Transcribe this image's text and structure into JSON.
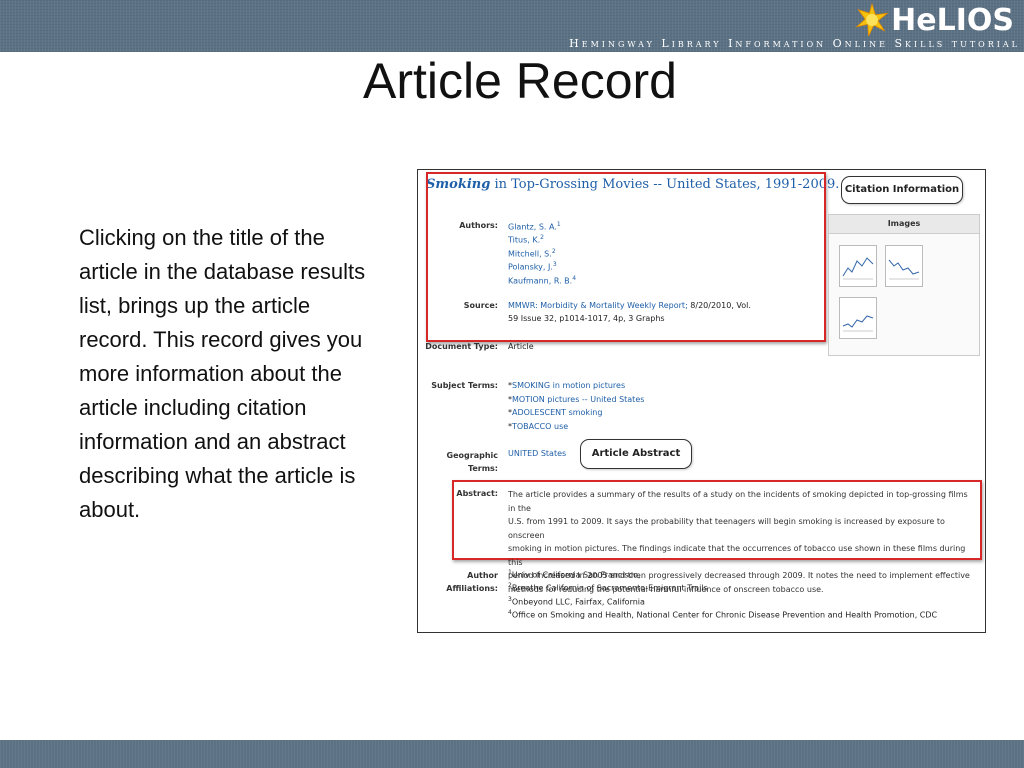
{
  "header": {
    "logo_text": "HeLIOS",
    "tagline": "Hemingway Library Information Online Skills tutorial"
  },
  "slide": {
    "title": "Article Record",
    "body": "Clicking on the title of the article in the database results list, brings up the article record.  This record gives you more information about the article including citation information and an abstract describing what the article is about."
  },
  "record": {
    "title_bold": "Smoking",
    "title_rest": " in Top-Grossing Movies -- United States, 1991-2009.",
    "callout_citation": "Citation Information",
    "callout_abstract": "Article Abstract",
    "images_header": "Images",
    "authors_label": "Authors:",
    "authors": [
      {
        "name": "Glantz, S. A.",
        "sup": "1"
      },
      {
        "name": "Titus, K.",
        "sup": "2"
      },
      {
        "name": "Mitchell, S.",
        "sup": "2"
      },
      {
        "name": "Polansky, J.",
        "sup": "3"
      },
      {
        "name": "Kaufmann, R. B.",
        "sup": "4"
      }
    ],
    "source_label": "Source:",
    "source_link": "MMWR: Morbidity & Mortality Weekly Report;",
    "source_line1_rest": " 8/20/2010, Vol.",
    "source_line2": "59 Issue 32, p1014-1017, 4p, 3 Graphs",
    "doctype_label": "Document Type:",
    "doctype": "Article",
    "subjects_label": "Subject Terms:",
    "subjects": [
      "SMOKING in motion pictures",
      "MOTION pictures -- United States",
      "ADOLESCENT smoking",
      "TOBACCO use"
    ],
    "geo_label_1": "Geographic",
    "geo_label_2": "Terms:",
    "geo": "UNITED States",
    "abstract_label": "Abstract:",
    "abstract_lines": [
      "The article provides a summary of the results of a study on the incidents of smoking depicted in top-grossing films in the",
      "U.S. from 1991 to 2009. It says the probability that teenagers will begin smoking is increased by exposure to onscreen",
      "smoking in motion pictures. The findings indicate that the occurrences of tobacco use shown in these films during this",
      "period increased in 2005 and then progressively decreased through 2009. It notes the need to implement effective",
      "methods for reducing the potential harmful influence of onscreen tobacco use."
    ],
    "affil_label_1": "Author",
    "affil_label_2": "Affiliations:",
    "affiliations": [
      {
        "sup": "1",
        "text": "Univ of California San Francisco,"
      },
      {
        "sup": "2",
        "text": "Breathe California of Sacramento-Emigrant Trails"
      },
      {
        "sup": "3",
        "text": "Onbeyond LLC, Fairfax, California"
      },
      {
        "sup": "4",
        "text": "Office on Smoking and Health, National Center for Chronic Disease Prevention and Health Promotion, CDC"
      }
    ]
  },
  "colors": {
    "banner": "#5b7184",
    "link": "#1f5fa8",
    "highlight_box": "#d62828"
  }
}
